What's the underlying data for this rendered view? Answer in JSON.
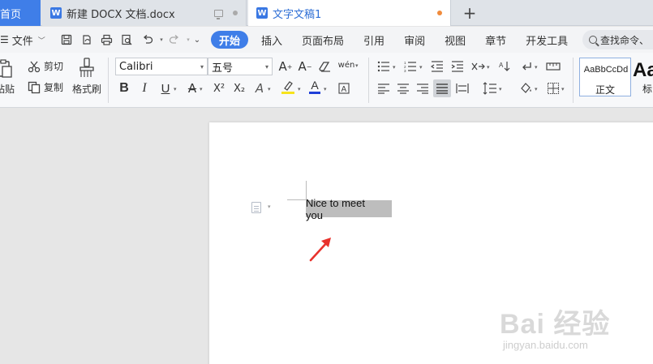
{
  "tabs": {
    "home": "首页",
    "doc1_title": "新建 DOCX 文档.docx",
    "doc2_title": "文字文稿1",
    "wps_glyph": "W",
    "new_tab": "+"
  },
  "menu": {
    "file_label": "文件",
    "items": [
      "开始",
      "插入",
      "页面布局",
      "引用",
      "审阅",
      "视图",
      "章节",
      "开发工具"
    ],
    "active_index": 0,
    "search_placeholder": "查找命令、"
  },
  "ribbon": {
    "paste_label": "粘贴",
    "cut_label": "剪切",
    "copy_label": "复制",
    "format_painter_label": "格式刷",
    "font_name": "Calibri",
    "font_size": "五号",
    "bold": "B",
    "italic": "I",
    "underline": "U",
    "superscript": "X²",
    "subscript": "X₂",
    "style_sample": "AaBbCcDd",
    "style_normal": "正文",
    "style_heading_sample": "Aa",
    "style_heading_name": "标"
  },
  "document": {
    "selected_text": "Nice to meet you"
  },
  "watermark": {
    "text": "Bai 经验",
    "sub": "jingyan.baidu.com"
  },
  "colors": {
    "accent": "#3f7ee8",
    "arrow": "#e8322c",
    "selection": "#bdbdbd"
  }
}
